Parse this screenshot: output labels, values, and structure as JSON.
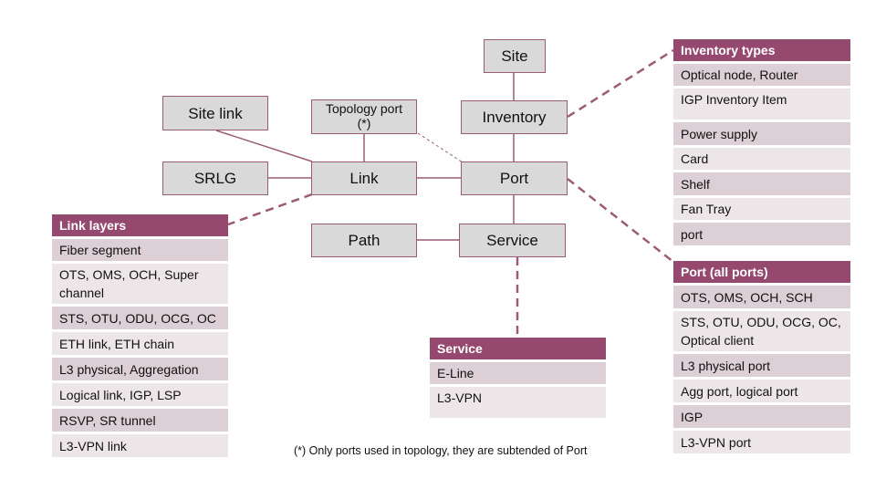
{
  "nodes": {
    "site": "Site",
    "inventory": "Inventory",
    "site_link": "Site link",
    "topology_port": "Topology port (*)",
    "srlg": "SRLG",
    "link": "Link",
    "port": "Port",
    "path": "Path",
    "service": "Service"
  },
  "inventory_types": {
    "title": "Inventory types",
    "rows": [
      "Optical node, Router",
      "IGP Inventory Item",
      "Power supply",
      "Card",
      "Shelf",
      "Fan Tray",
      "port"
    ]
  },
  "port_all": {
    "title": "Port (all ports)",
    "rows": [
      "OTS, OMS, OCH, SCH",
      "STS, OTU, ODU, OCG, OC, Optical client",
      "L3 physical port",
      "Agg port, logical port",
      "IGP",
      "L3-VPN port"
    ]
  },
  "link_layers": {
    "title": "Link layers",
    "rows": [
      "Fiber segment",
      "OTS, OMS, OCH, Super channel",
      "STS, OTU, ODU, OCG, OC",
      "ETH link, ETH chain",
      "L3 physical, Aggregation",
      "Logical link, IGP, LSP",
      "RSVP, SR tunnel",
      "L3-VPN link"
    ]
  },
  "service_types": {
    "title": "Service",
    "rows": [
      "E-Line",
      "L3-VPN"
    ]
  },
  "footnote": "(*) Only ports used in topology, they are subtended of Port",
  "colors": {
    "accent": "#96496f",
    "node_fill": "#d9d9d9",
    "row_odd": "#dccfd5",
    "row_even": "#ede6e9",
    "line": "#9a5a78"
  }
}
